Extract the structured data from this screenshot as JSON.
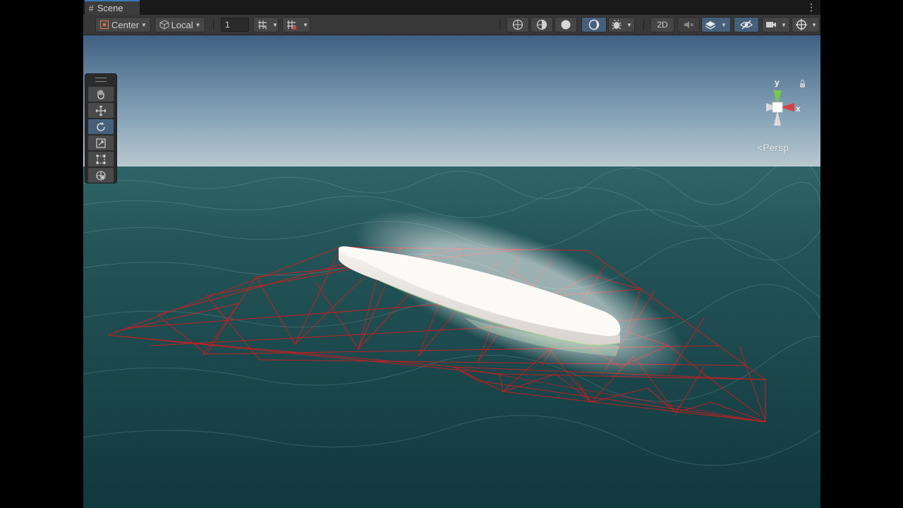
{
  "tab": {
    "title": "Scene",
    "hash_icon": "#",
    "menu_icon": "⋮"
  },
  "toolbar": {
    "pivot_label": "Center",
    "handle_label": "Local",
    "snap_value": "1",
    "mode_2d": "2D"
  },
  "gizmo": {
    "y_label": "y",
    "x_label": "x",
    "projection": "Persp",
    "projection_icon": "<"
  },
  "colors": {
    "accent": "#3a79bb",
    "active": "#46607c",
    "wire": "#e01818",
    "sky_top": "#4c6d8e",
    "sea": "#1d4a4c"
  }
}
